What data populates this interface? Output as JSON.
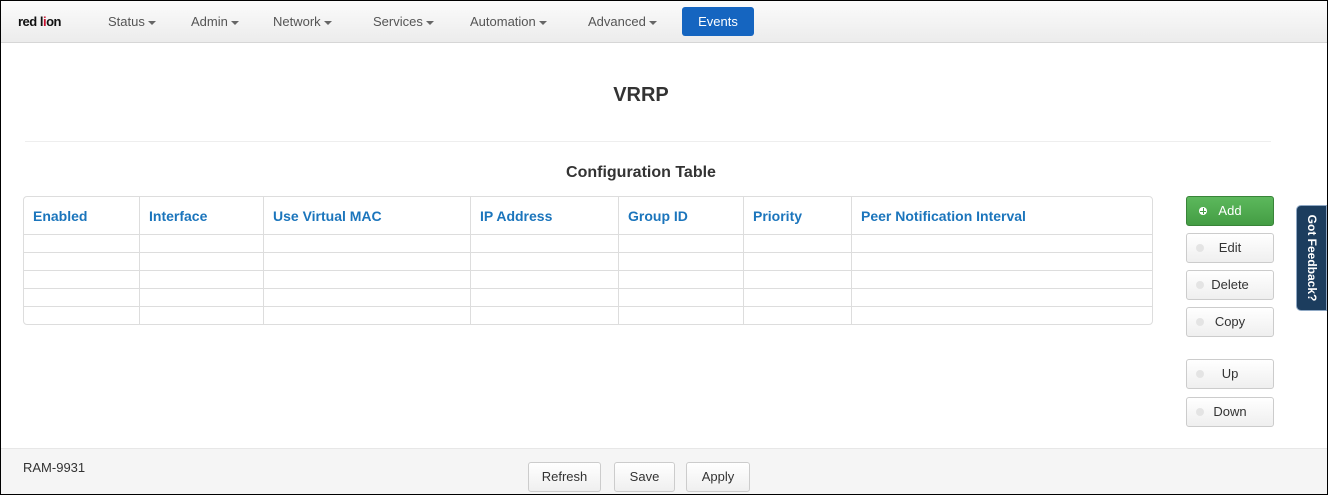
{
  "brand": {
    "logo_text_1": "red l",
    "logo_text_2": "i",
    "logo_text_3": "on"
  },
  "nav": {
    "items": [
      {
        "label": "Status"
      },
      {
        "label": "Admin"
      },
      {
        "label": "Network"
      },
      {
        "label": "Services"
      },
      {
        "label": "Automation"
      },
      {
        "label": "Advanced"
      }
    ],
    "events_label": "Events",
    "accent": "#1565c0"
  },
  "page": {
    "title": "VRRP",
    "subtitle": "Configuration Table"
  },
  "table": {
    "columns": [
      "Enabled",
      "Interface",
      "Use Virtual MAC",
      "IP Address",
      "Group ID",
      "Priority",
      "Peer Notification Interval"
    ],
    "rows": [
      [
        "",
        "",
        "",
        "",
        "",
        "",
        ""
      ],
      [
        "",
        "",
        "",
        "",
        "",
        "",
        ""
      ],
      [
        "",
        "",
        "",
        "",
        "",
        "",
        ""
      ],
      [
        "",
        "",
        "",
        "",
        "",
        "",
        ""
      ],
      [
        "",
        "",
        "",
        "",
        "",
        "",
        ""
      ]
    ]
  },
  "actions": {
    "add": "Add",
    "edit": "Edit",
    "delete": "Delete",
    "copy": "Copy",
    "up": "Up",
    "down": "Down",
    "add_color": "#5cb85c"
  },
  "feedback": {
    "label": "Got Feedback?"
  },
  "footer": {
    "device": "RAM-9931",
    "refresh": "Refresh",
    "save": "Save",
    "apply": "Apply"
  }
}
